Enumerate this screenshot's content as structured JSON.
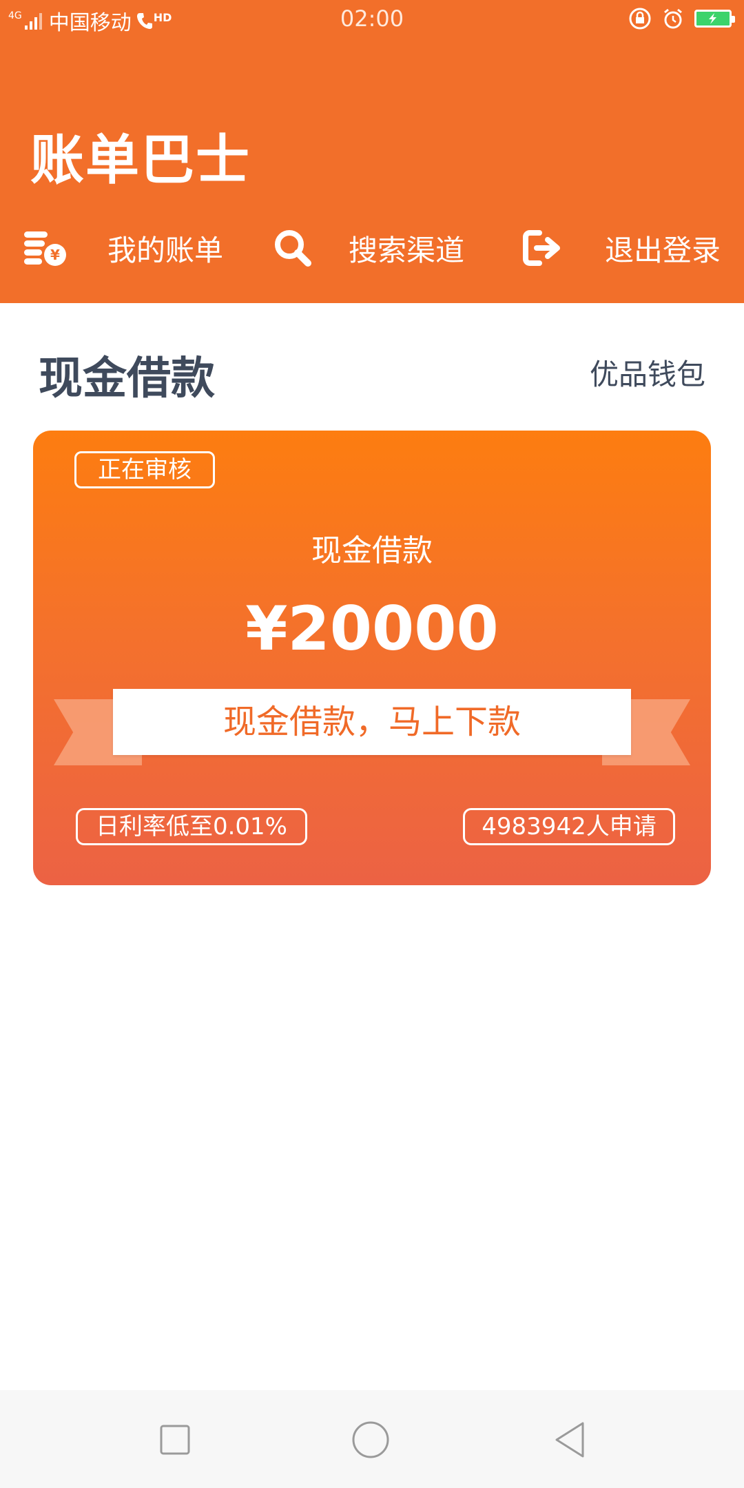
{
  "status_bar": {
    "signal_label": "4G",
    "carrier": "中国移动",
    "hd_label": "HD",
    "time": "02:00"
  },
  "app": {
    "title": "账单巴士"
  },
  "nav": {
    "items": [
      {
        "label": "我的账单",
        "icon": "coin-stack-icon"
      },
      {
        "label": "搜索渠道",
        "icon": "search-icon"
      },
      {
        "label": "退出登录",
        "icon": "logout-icon"
      }
    ]
  },
  "section": {
    "title": "现金借款",
    "link": "优品钱包"
  },
  "card": {
    "status_badge": "正在审核",
    "subtitle": "现金借款",
    "amount": "¥20000",
    "banner": "现金借款，马上下款",
    "rate_pill": "日利率低至0.01%",
    "applicants_pill": "4983942人申请"
  },
  "colors": {
    "header": "#f26f2a",
    "card_top": "#fd7d10",
    "card_bottom": "#ec6244",
    "title_text": "#3f4a5c",
    "banner_text": "#f06a28"
  }
}
